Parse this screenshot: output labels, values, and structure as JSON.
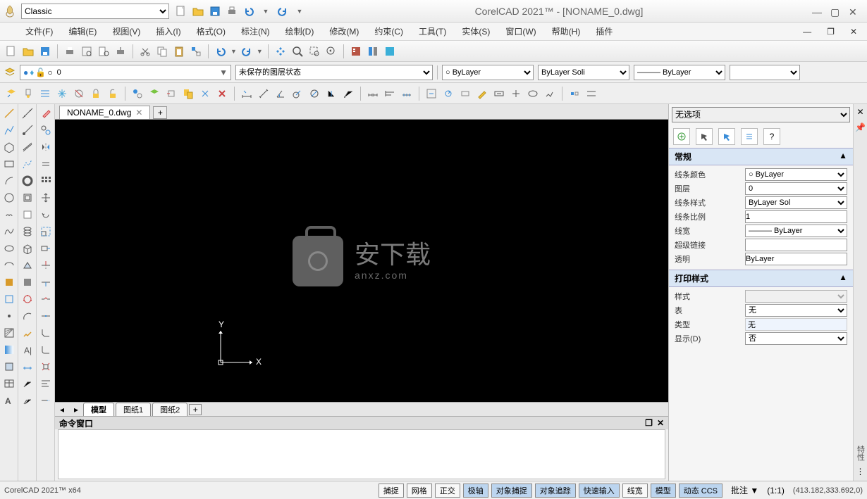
{
  "app": {
    "workspace": "Classic",
    "title": "CorelCAD 2021™ - [NONAME_0.dwg]",
    "product": "CorelCAD 2021™ x64"
  },
  "menu": [
    "文件(F)",
    "编辑(E)",
    "视图(V)",
    "插入(I)",
    "格式(O)",
    "标注(N)",
    "绘制(D)",
    "修改(M)",
    "约束(C)",
    "工具(T)",
    "实体(S)",
    "窗口(W)",
    "帮助(H)",
    "插件"
  ],
  "layer": {
    "current": "0",
    "state": "未保存的图层状态",
    "color": "○ ByLayer",
    "ltype": "ByLayer    Soli",
    "lweight": "——— ByLayer",
    "blank": ""
  },
  "tabs": {
    "main": "NONAME_0.dwg",
    "bottom": [
      "模型",
      "图纸1",
      "图纸2"
    ]
  },
  "watermark": {
    "text": "安下载",
    "sub": "anxz.com"
  },
  "props": {
    "none": "无选项",
    "sections": {
      "general": "常规",
      "print": "打印样式"
    },
    "general": {
      "color_label": "线条颜色",
      "color": "○ ByLayer",
      "layer_label": "图层",
      "layer": "0",
      "ltype_label": "线条样式",
      "ltype": "ByLayer     Sol",
      "lscale_label": "线条比例",
      "lscale": "1",
      "lweight_label": "线宽",
      "lweight": "——— ByLayer",
      "hyper_label": "超级链接",
      "hyper": "",
      "trans_label": "透明",
      "trans": "ByLayer"
    },
    "print": {
      "style_label": "样式",
      "style": "",
      "table_label": "表",
      "table": "无",
      "type_label": "类型",
      "type": "无",
      "show_label": "显示(D)",
      "show": "否"
    }
  },
  "cmd": {
    "title": "命令窗口"
  },
  "status": {
    "buttons": [
      {
        "t": "捕捉",
        "a": false
      },
      {
        "t": "网格",
        "a": false
      },
      {
        "t": "正交",
        "a": false
      },
      {
        "t": "极轴",
        "a": true
      },
      {
        "t": "对象捕捉",
        "a": true
      },
      {
        "t": "对象追踪",
        "a": true
      },
      {
        "t": "快速输入",
        "a": true
      },
      {
        "t": "线宽",
        "a": false
      },
      {
        "t": "模型",
        "a": true
      },
      {
        "t": "动态 CCS",
        "a": true
      }
    ],
    "annotate": "批注 ▼",
    "scale": "(1:1)",
    "coords": "(413.182,333.692,0)"
  }
}
